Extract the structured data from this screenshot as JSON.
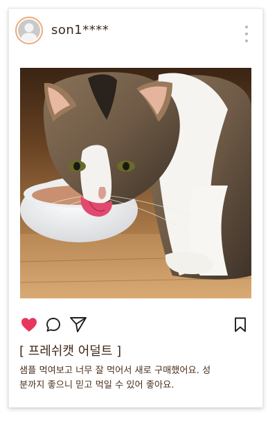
{
  "post": {
    "username": "son1****",
    "product_title": "[ 프레쉬캣 어덜트 ]",
    "description_lines": [
      "샘플 먹여보고 너무 잘 먹어서 새로 구매했어요. 성",
      "분까지 좋으니 믿고 먹일 수 있어 좋아요."
    ]
  },
  "icons": {
    "avatar": "default-user-avatar",
    "more": "more-vertical-icon",
    "like": "heart-icon",
    "comment": "comment-icon",
    "share": "send-icon",
    "save": "bookmark-icon"
  },
  "colors": {
    "like_active": "#e8365d",
    "avatar_ring": "#f0a878",
    "title_text": "#3e2818",
    "body_text": "#4a2e1a"
  }
}
